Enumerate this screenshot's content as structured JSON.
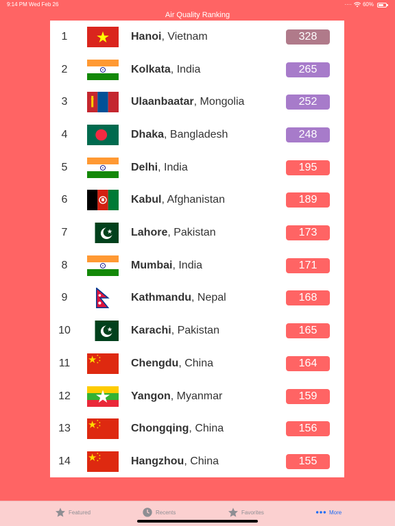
{
  "status": {
    "time": "9:14 PM",
    "date": "Wed Feb 26",
    "battery": "60%"
  },
  "nav": {
    "title": "Air Quality Ranking"
  },
  "colors": {
    "background": "#ff6464",
    "hazardous": "#b07a8a",
    "very_unhealthy": "#a77bca",
    "unhealthy": "#ff6464"
  },
  "rows": [
    {
      "rank": "1",
      "city": "Hanoi",
      "country": ", Vietnam",
      "aqi": "328",
      "flag": "vietnam",
      "color": "#b07a8a"
    },
    {
      "rank": "2",
      "city": "Kolkata",
      "country": ", India",
      "aqi": "265",
      "flag": "india",
      "color": "#a77bca"
    },
    {
      "rank": "3",
      "city": "Ulaanbaatar",
      "country": ", Mongolia",
      "aqi": "252",
      "flag": "mongolia",
      "color": "#a77bca"
    },
    {
      "rank": "4",
      "city": "Dhaka",
      "country": ", Bangladesh",
      "aqi": "248",
      "flag": "bangladesh",
      "color": "#a77bca"
    },
    {
      "rank": "5",
      "city": "Delhi",
      "country": ", India",
      "aqi": "195",
      "flag": "india",
      "color": "#ff6464"
    },
    {
      "rank": "6",
      "city": "Kabul",
      "country": ", Afghanistan",
      "aqi": "189",
      "flag": "afghanistan",
      "color": "#ff6464"
    },
    {
      "rank": "7",
      "city": "Lahore",
      "country": ", Pakistan",
      "aqi": "173",
      "flag": "pakistan",
      "color": "#ff6464"
    },
    {
      "rank": "8",
      "city": "Mumbai",
      "country": ", India",
      "aqi": "171",
      "flag": "india",
      "color": "#ff6464"
    },
    {
      "rank": "9",
      "city": "Kathmandu",
      "country": ", Nepal",
      "aqi": "168",
      "flag": "nepal",
      "color": "#ff6464"
    },
    {
      "rank": "10",
      "city": "Karachi",
      "country": ", Pakistan",
      "aqi": "165",
      "flag": "pakistan",
      "color": "#ff6464"
    },
    {
      "rank": "11",
      "city": "Chengdu",
      "country": ", China",
      "aqi": "164",
      "flag": "china",
      "color": "#ff6464"
    },
    {
      "rank": "12",
      "city": "Yangon",
      "country": ", Myanmar",
      "aqi": "159",
      "flag": "myanmar",
      "color": "#ff6464"
    },
    {
      "rank": "13",
      "city": "Chongqing",
      "country": ", China",
      "aqi": "156",
      "flag": "china",
      "color": "#ff6464"
    },
    {
      "rank": "14",
      "city": "Hangzhou",
      "country": ", China",
      "aqi": "155",
      "flag": "china",
      "color": "#ff6464"
    }
  ],
  "tabs": [
    {
      "label": "Featured",
      "icon": "star-icon",
      "active": false
    },
    {
      "label": "Recents",
      "icon": "clock-icon",
      "active": false
    },
    {
      "label": "Favorites",
      "icon": "star-icon",
      "active": false
    },
    {
      "label": "More",
      "icon": "more-icon",
      "active": true
    }
  ]
}
